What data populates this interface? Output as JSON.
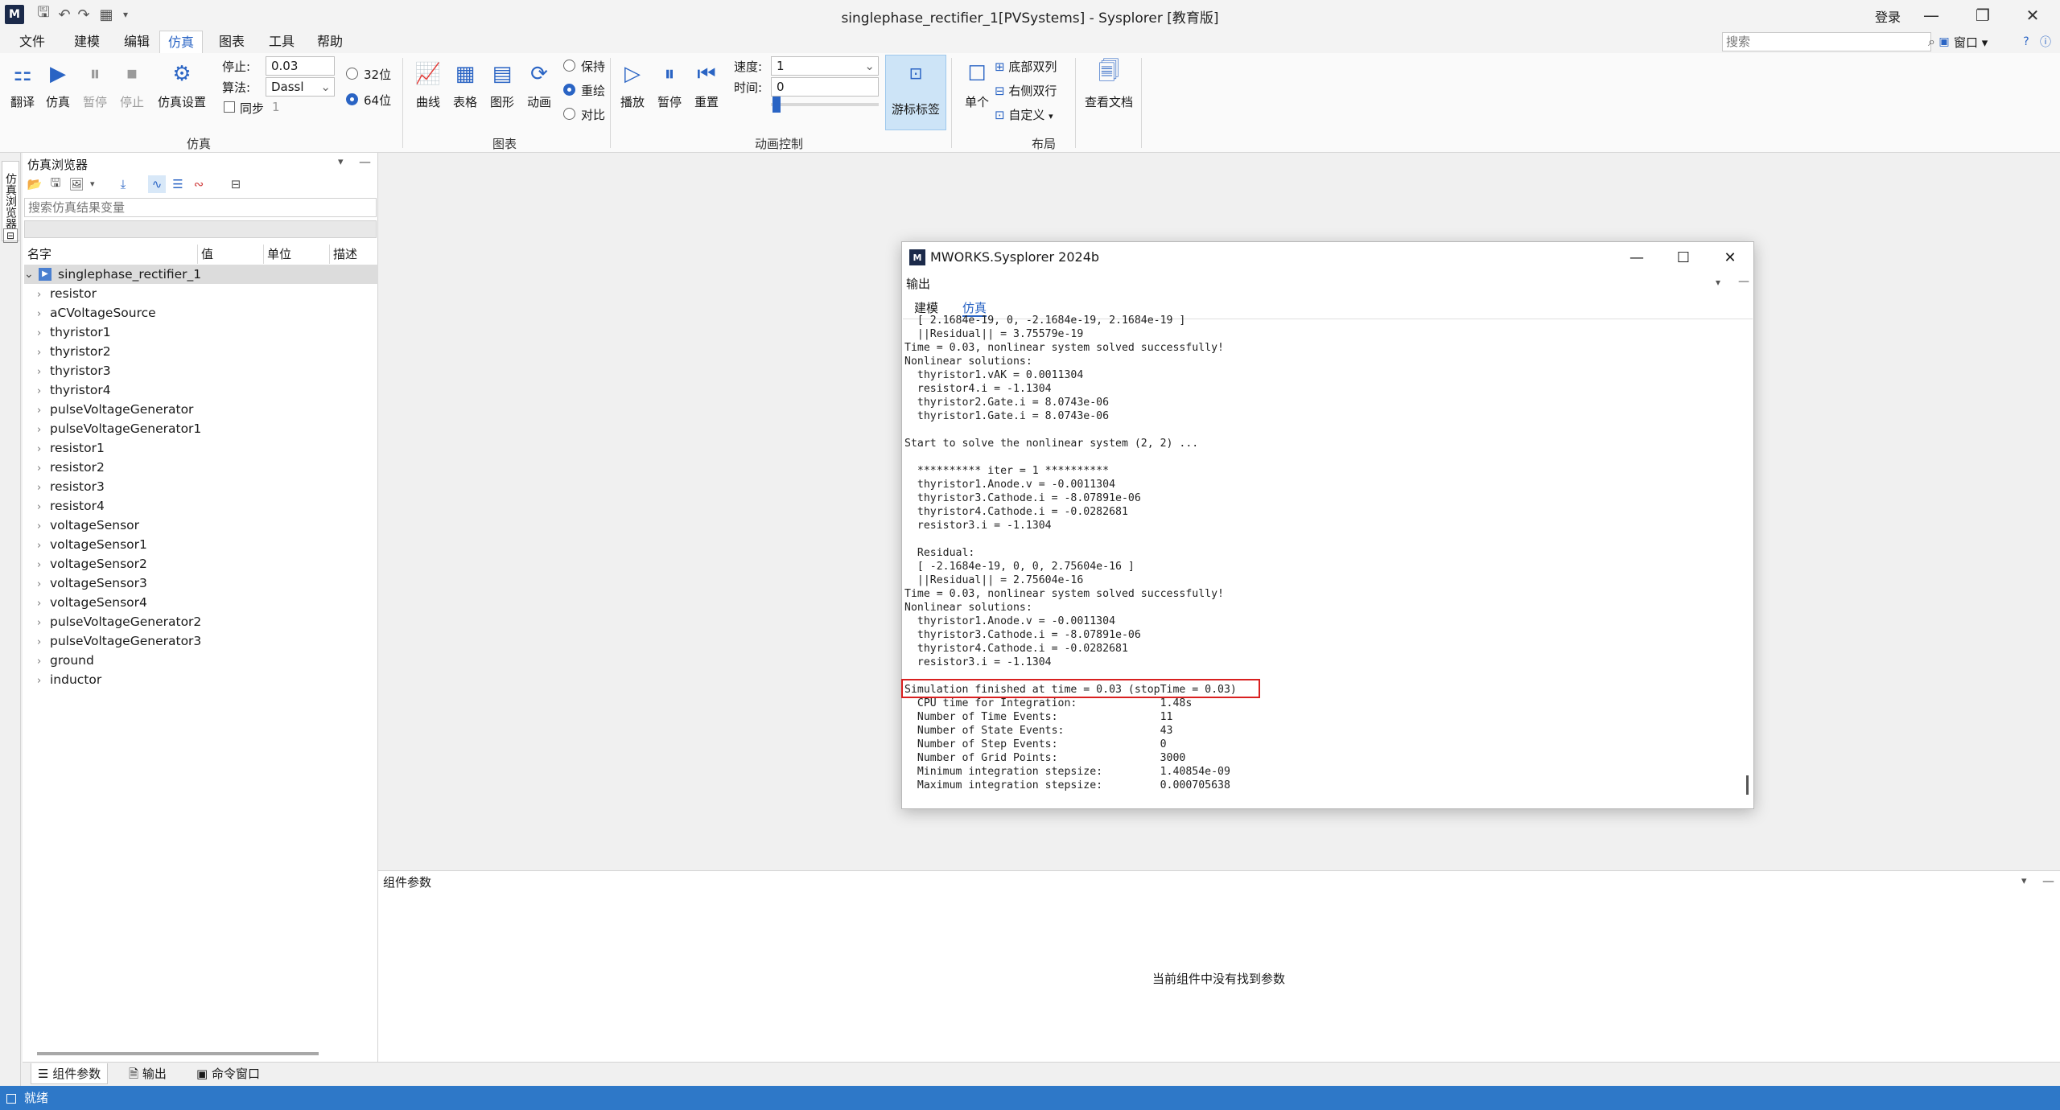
{
  "window": {
    "title": "singlephase_rectifier_1[PVSystems] - Sysplorer [教育版]",
    "login": "登录"
  },
  "menu": [
    "文件",
    "建模",
    "编辑",
    "仿真",
    "图表",
    "工具",
    "帮助"
  ],
  "menu_active": "仿真",
  "search": {
    "placeholder": "搜索",
    "window_label": "窗口"
  },
  "ribbon": {
    "sim_buttons": [
      "翻译",
      "仿真",
      "暂停",
      "停止",
      "仿真设置"
    ],
    "stop_label": "停止:",
    "stop_value": "0.03",
    "algo_label": "算法:",
    "algo_value": "Dassl",
    "sync_label": "同步",
    "sync_value": "1",
    "bit32": "32位",
    "bit64": "64位",
    "group_sim": "仿真",
    "chart_buttons": [
      "曲线",
      "表格",
      "图形",
      "动画"
    ],
    "redraw_options": [
      "保持",
      "重绘",
      "对比"
    ],
    "group_chart": "图表",
    "anim_buttons": [
      "播放",
      "暂停",
      "重置"
    ],
    "speed_label": "速度:",
    "speed_value": "1",
    "time_label": "时间:",
    "time_value": "0",
    "group_anim": "动画控制",
    "tracker": "游标标签",
    "single": "单个",
    "layout_options": [
      "底部双列",
      "右侧双行",
      "自定义"
    ],
    "group_layout": "布局",
    "view_doc": "查看文档"
  },
  "side_tab": "仿真浏览器",
  "browser": {
    "title": "仿真浏览器",
    "search_placeholder": "搜索仿真结果变量",
    "columns": [
      "名字",
      "值",
      "单位",
      "描述"
    ],
    "root": "singlephase_rectifier_1",
    "items": [
      "resistor",
      "aCVoltageSource",
      "thyristor1",
      "thyristor2",
      "thyristor3",
      "thyristor4",
      "pulseVoltageGenerator",
      "pulseVoltageGenerator1",
      "resistor1",
      "resistor2",
      "resistor3",
      "resistor4",
      "voltageSensor",
      "voltageSensor1",
      "voltageSensor2",
      "voltageSensor3",
      "voltageSensor4",
      "pulseVoltageGenerator2",
      "pulseVoltageGenerator3",
      "ground",
      "inductor"
    ]
  },
  "dialog": {
    "title": "MWORKS.Sysplorer 2024b",
    "subtitle": "输出",
    "tabs": [
      "建模",
      "仿真"
    ],
    "active_tab": "仿真",
    "console": "  [ 2.1684e-19, 0, -2.1684e-19, 2.1684e-19 ]\n  ||Residual|| = 3.75579e-19\nTime = 0.03, nonlinear system solved successfully!\nNonlinear solutions:\n  thyristor1.vAK = 0.0011304\n  resistor4.i = -1.1304\n  thyristor2.Gate.i = 8.0743e-06\n  thyristor1.Gate.i = 8.0743e-06\n\nStart to solve the nonlinear system (2, 2) ...\n\n  ********** iter = 1 **********\n  thyristor1.Anode.v = -0.0011304\n  thyristor3.Cathode.i = -8.07891e-06\n  thyristor4.Cathode.i = -0.0282681\n  resistor3.i = -1.1304\n\n  Residual:\n  [ -2.1684e-19, 0, 0, 2.75604e-16 ]\n  ||Residual|| = 2.75604e-16\nTime = 0.03, nonlinear system solved successfully!\nNonlinear solutions:\n  thyristor1.Anode.v = -0.0011304\n  thyristor3.Cathode.i = -8.07891e-06\n  thyristor4.Cathode.i = -0.0282681\n  resistor3.i = -1.1304\n\nSimulation finished at time = 0.03 (stopTime = 0.03)\n  CPU time for Integration:             1.48s\n  Number of Time Events:                11\n  Number of State Events:               43\n  Number of Step Events:                0\n  Number of Grid Points:                3000\n  Minimum integration stepsize:         1.40854e-09\n  Maximum integration stepsize:         0.000705638"
  },
  "params": {
    "title": "组件参数",
    "empty": "当前组件中没有找到参数"
  },
  "bottom_tabs": [
    "组件参数",
    "输出",
    "命令窗口"
  ],
  "status": "就绪",
  "colors": {
    "accent": "#2a64c4",
    "status_bar": "#2e78c8",
    "highlight": "#d92020"
  }
}
